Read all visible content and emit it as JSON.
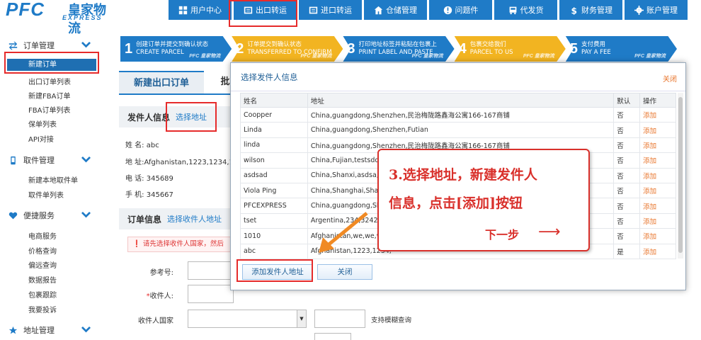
{
  "logo": {
    "brand": "PFC",
    "cn": "皇家物流",
    "en": "EXPRESS"
  },
  "nav": [
    {
      "label": "用户中心",
      "icon": "grid-icon"
    },
    {
      "label": "出口转运",
      "icon": "export-icon"
    },
    {
      "label": "进口转运",
      "icon": "import-icon"
    },
    {
      "label": "仓储管理",
      "icon": "warehouse-icon"
    },
    {
      "label": "问题件",
      "icon": "warning-icon"
    },
    {
      "label": "代发货",
      "icon": "bus-icon"
    },
    {
      "label": "财务管理",
      "icon": "dollar-icon"
    },
    {
      "label": "账户管理",
      "icon": "gear-icon"
    }
  ],
  "sidebar": {
    "g1": "订单管理",
    "g1_items": [
      "新建订单",
      "出口订单列表",
      "新建FBA订单",
      "FBA订单列表",
      "保单列表",
      "API对接"
    ],
    "g2": "取件管理",
    "g2_items": [
      "新建本地取件单",
      "取件单列表"
    ],
    "g3": "便捷服务",
    "g3_items": [
      "电商服务",
      "价格查询",
      "偏远查询",
      "数据报告",
      "包裹跟踪",
      "我要投诉"
    ],
    "g4": "地址管理"
  },
  "steps": [
    {
      "num": "1",
      "cn": "创建订单并提交到确认状态",
      "en": "CREATE  PARCEL"
    },
    {
      "num": "2",
      "cn": "订单提交到确认状态",
      "en": "TRANSFERRED TO CONFIRM"
    },
    {
      "num": "3",
      "cn": "打印地址标签并粘贴在包裹上",
      "en": "PRINT LABEL AND PASTE"
    },
    {
      "num": "4",
      "cn": "包裹交给我们",
      "en": "PARCEL TO US"
    },
    {
      "num": "5",
      "cn": "支付费用",
      "en": "PAY A FEE"
    }
  ],
  "step_tag": "PFC 皇家物流",
  "tabs": {
    "active": "新建出口订单",
    "other": "批"
  },
  "sender": {
    "title": "发件人信息",
    "link": "选择地址",
    "name": "姓 名: abc",
    "addr": "地 址:Afghanistan,1223,1234,123",
    "phone": "电 话: 345689",
    "mobile": "手 机: 345667"
  },
  "order": {
    "title": "订单信息",
    "link": "选择收件人地址",
    "alert": "请先选择收件人国家，然后"
  },
  "form": {
    "ref": "参考号:",
    "receiver": "收件人:",
    "country": "收件人国家",
    "req": "*",
    "arrow": "▼",
    "note": "支持模糊查询"
  },
  "modal": {
    "title": "选择发件人信息",
    "close": "关闭",
    "headers": [
      "姓名",
      "地址",
      "默认",
      "操作"
    ],
    "rows": [
      [
        "Coopper",
        "China,guangdong,Shenzhen,民治梅陇路鑫海公寓166-167商铺",
        "否",
        "添加"
      ],
      [
        "Linda",
        "China,guangdong,Shenzhen,Futian",
        "否",
        "添加"
      ],
      [
        "linda",
        "China,guangdong,Shenzhen,民治梅陇路鑫海公寓166-167商铺",
        "否",
        "添加"
      ],
      [
        "wilson",
        "China,Fujian,testsdds",
        "否",
        "添加"
      ],
      [
        "asdsad",
        "China,Shanxi,asdsa,a",
        "否",
        "添加"
      ],
      [
        "Viola Ping",
        "China,Shanghai,Shang",
        "否",
        "添加"
      ],
      [
        "PFCEXPRESS",
        "China,guangdong,Sh",
        "否",
        "添加"
      ],
      [
        "tset",
        "Argentina,234,3242",
        "否",
        "添加"
      ],
      [
        "1010",
        "Afghanistan,we,we,we",
        "否",
        "添加"
      ],
      [
        "abc",
        "Afghanistan,1223,1234,",
        "是",
        "添加"
      ]
    ],
    "btn_add": "添加发件人地址",
    "btn_close": "关闭"
  },
  "annotation": {
    "line1": "3.选择地址，新建发件人",
    "line2": "信息，点击[添加]按钮",
    "line3": "下一步",
    "arrow": "⟶"
  },
  "colors": {
    "primary": "#1f7bc7",
    "step_active": "#f2b421",
    "highlight": "#e62b2b",
    "link_orange": "#e8742a"
  }
}
